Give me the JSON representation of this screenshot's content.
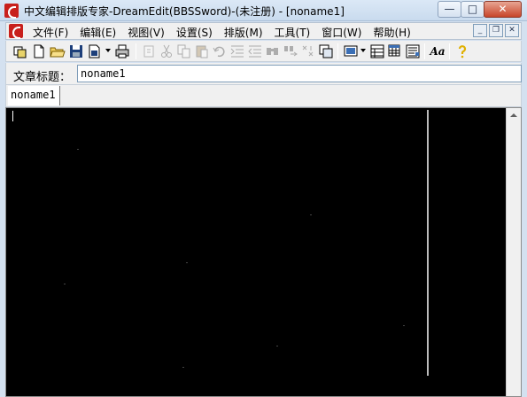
{
  "window": {
    "title": "中文编辑排版专家-DreamEdit(BBSSword)-(未注册) - [noname1]",
    "controls": {
      "minimize": "—",
      "maximize": "□",
      "close": "✕"
    }
  },
  "menubar": {
    "items": [
      {
        "label": "文件(F)"
      },
      {
        "label": "编辑(E)"
      },
      {
        "label": "视图(V)"
      },
      {
        "label": "设置(S)"
      },
      {
        "label": "排版(M)"
      },
      {
        "label": "工具(T)"
      },
      {
        "label": "窗口(W)"
      },
      {
        "label": "帮助(H)"
      }
    ],
    "mdi_controls": {
      "minimize": "_",
      "restore": "❐",
      "close": "✕"
    }
  },
  "toolbar": {
    "buttons": [
      "open-multiple",
      "new-file",
      "open-file",
      "save",
      "save-as",
      "print",
      "paste-special",
      "cut",
      "copy",
      "paste",
      "undo",
      "indent",
      "outdent",
      "find",
      "replace",
      "wrap-lines",
      "copy-window",
      "display-options",
      "table-layout",
      "insert-table",
      "format-paragraph",
      "font",
      "help"
    ],
    "font_button_label": "Aa"
  },
  "title_field": {
    "label": "文章标题：",
    "value": "noname1"
  },
  "tabs": [
    {
      "label": "noname1"
    }
  ],
  "editor": {
    "content": "",
    "background": "#000000",
    "margin_line_color": "#bcbcbc"
  }
}
